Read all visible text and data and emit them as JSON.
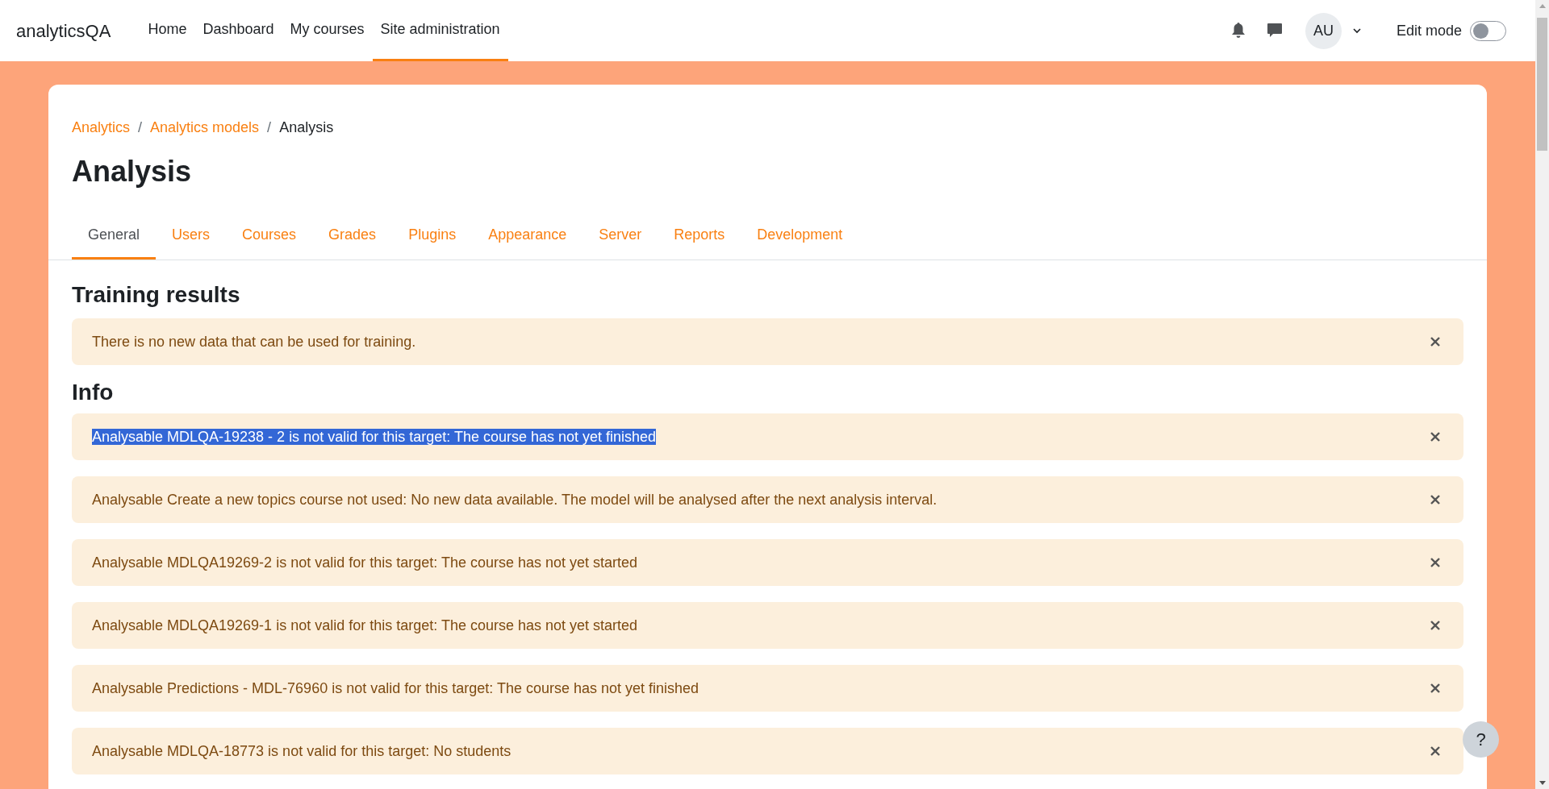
{
  "navbar": {
    "brand": "analyticsQA",
    "links": [
      {
        "label": "Home",
        "selected": false
      },
      {
        "label": "Dashboard",
        "selected": false
      },
      {
        "label": "My courses",
        "selected": false
      },
      {
        "label": "Site administration",
        "selected": true
      }
    ],
    "avatar": "AU",
    "edit_mode": {
      "label": "Edit mode",
      "on": false
    }
  },
  "breadcrumb_separator": "/",
  "breadcrumb": [
    {
      "label": "Analytics",
      "link": true
    },
    {
      "label": "Analytics models",
      "link": true
    },
    {
      "label": "Analysis",
      "link": false
    }
  ],
  "title": "Analysis",
  "tabs": [
    {
      "label": "General",
      "selected": true
    },
    {
      "label": "Users",
      "selected": false
    },
    {
      "label": "Courses",
      "selected": false
    },
    {
      "label": "Grades",
      "selected": false
    },
    {
      "label": "Plugins",
      "selected": false
    },
    {
      "label": "Appearance",
      "selected": false
    },
    {
      "label": "Server",
      "selected": false
    },
    {
      "label": "Reports",
      "selected": false
    },
    {
      "label": "Development",
      "selected": false
    }
  ],
  "sections": [
    {
      "heading": "Training results",
      "alerts": [
        {
          "text": "There is no new data that can be used for training.",
          "selected": false
        }
      ]
    },
    {
      "heading": "Info",
      "alerts": [
        {
          "text": "Analysable MDLQA-19238 - 2 is not valid for this target: The course has not yet finished",
          "selected": true
        },
        {
          "text": "Analysable Create a new topics course not used: No new data available. The model will be analysed after the next analysis interval.",
          "selected": false
        },
        {
          "text": "Analysable MDLQA19269-2 is not valid for this target: The course has not yet started",
          "selected": false
        },
        {
          "text": "Analysable MDLQA19269-1 is not valid for this target: The course has not yet started",
          "selected": false
        },
        {
          "text": "Analysable Predictions - MDL-76960 is not valid for this target: The course has not yet finished",
          "selected": false
        },
        {
          "text": "Analysable MDLQA-18773 is not valid for this target: No students",
          "selected": false
        }
      ]
    }
  ],
  "help_button": "?"
}
